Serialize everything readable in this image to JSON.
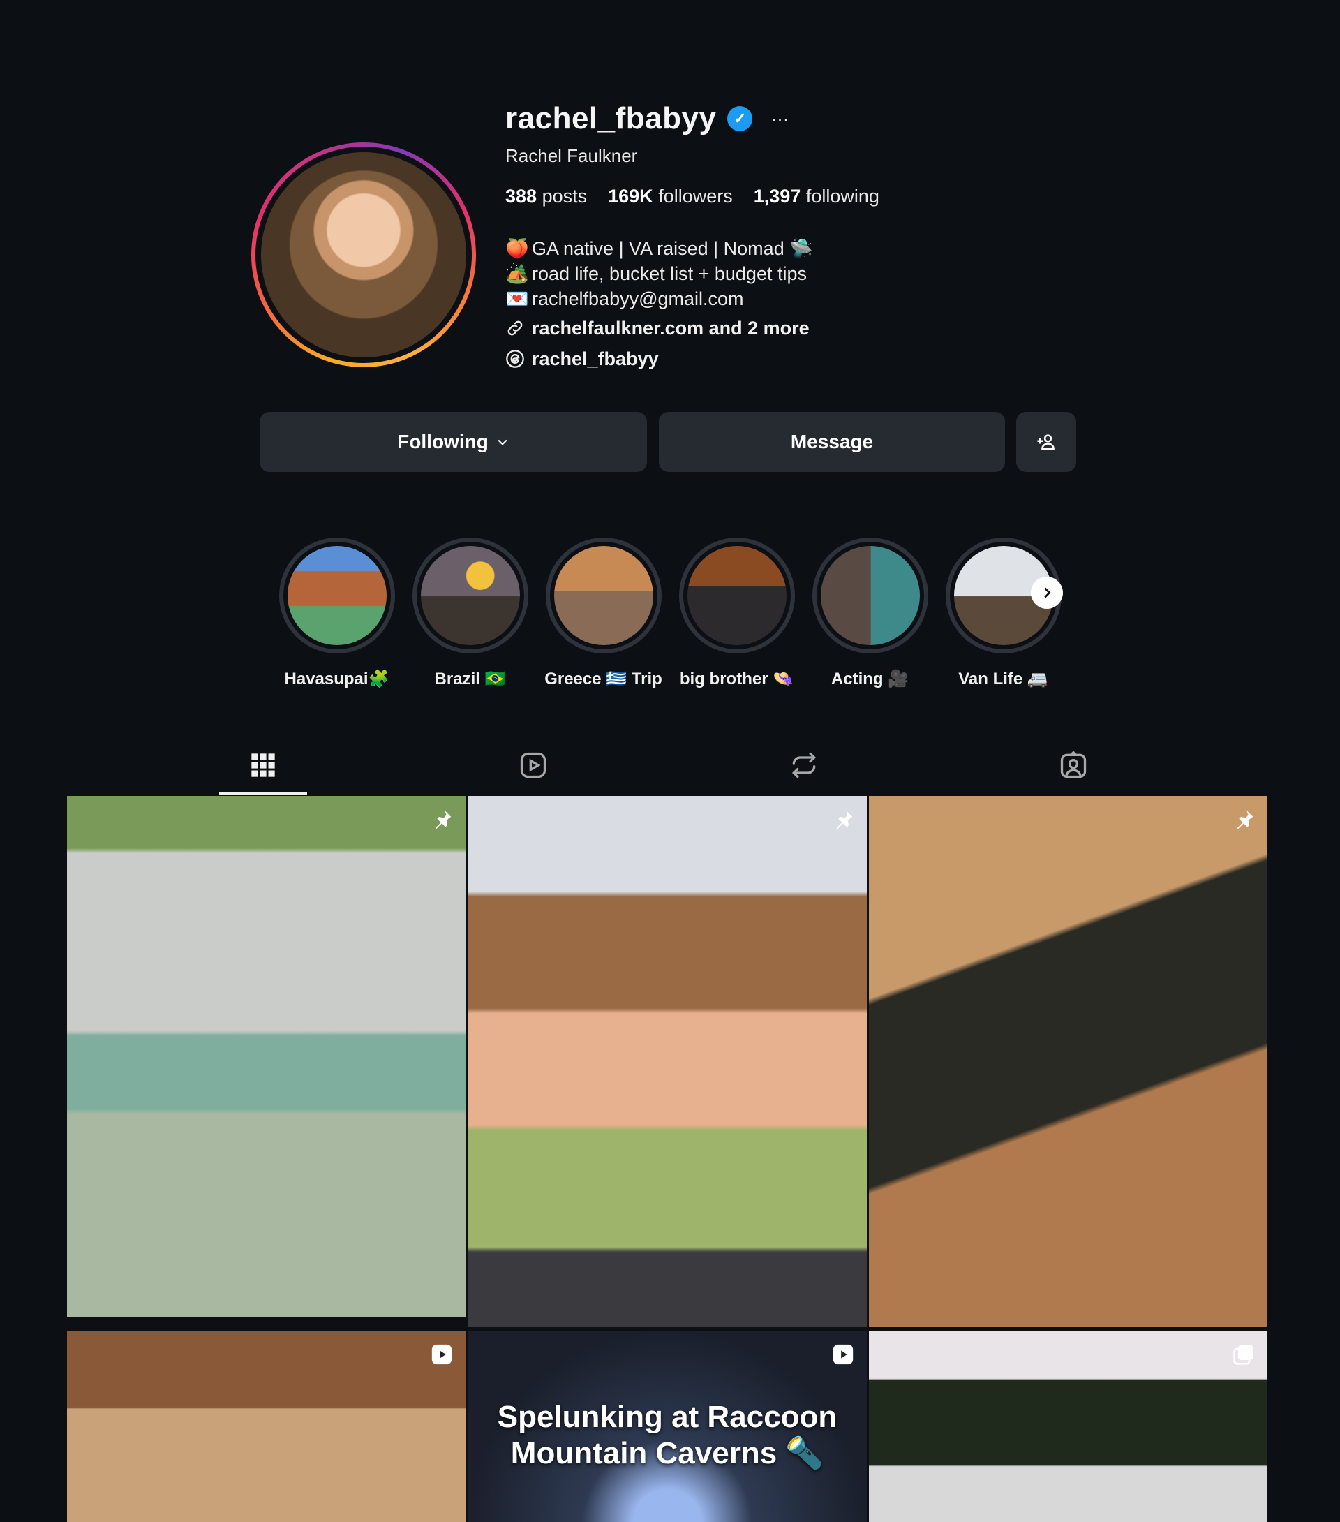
{
  "profile": {
    "username": "rachel_fbabyy",
    "full_name": "Rachel Faulkner",
    "verified_icon": "verified-badge-icon",
    "more_label": "···",
    "stats": {
      "posts_count": "388",
      "posts_label": "posts",
      "followers_count": "169K",
      "followers_label": "followers",
      "following_count": "1,397",
      "following_label": "following"
    },
    "bio": [
      {
        "emoji": "🍑",
        "text": "GA native | VA raised | Nomad 🛸"
      },
      {
        "emoji": "🏕️",
        "text": "road life, bucket list + budget tips"
      },
      {
        "emoji": "💌",
        "text": "rachelfbabyy@gmail.com"
      }
    ],
    "link_text": "rachelfaulkner.com and 2 more",
    "threads_handle": "rachel_fbabyy"
  },
  "actions": {
    "following_label": "Following",
    "message_label": "Message",
    "add_user_icon": "add-user-icon"
  },
  "highlights": [
    {
      "label": "Havasupai🧩"
    },
    {
      "label": "Brazil 🇧🇷"
    },
    {
      "label": "Greece 🇬🇷 Trip"
    },
    {
      "label": "big brother 👒"
    },
    {
      "label": "Acting 🎥"
    },
    {
      "label": "Van Life 🚐"
    }
  ],
  "tabs": [
    "grid-icon",
    "reels-icon",
    "reposts-icon",
    "tagged-icon"
  ],
  "posts": [
    {
      "type": "pinned",
      "caption": ""
    },
    {
      "type": "pinned",
      "caption": ""
    },
    {
      "type": "pinned",
      "caption": ""
    },
    {
      "type": "reel",
      "caption": ""
    },
    {
      "type": "reel",
      "caption": "Spelunking at Raccoon Mountain Caverns 🔦"
    },
    {
      "type": "carousel",
      "caption": ""
    }
  ],
  "colors": {
    "background": "#0c0f14",
    "button": "#262a31",
    "verified": "#1d9bf0"
  }
}
